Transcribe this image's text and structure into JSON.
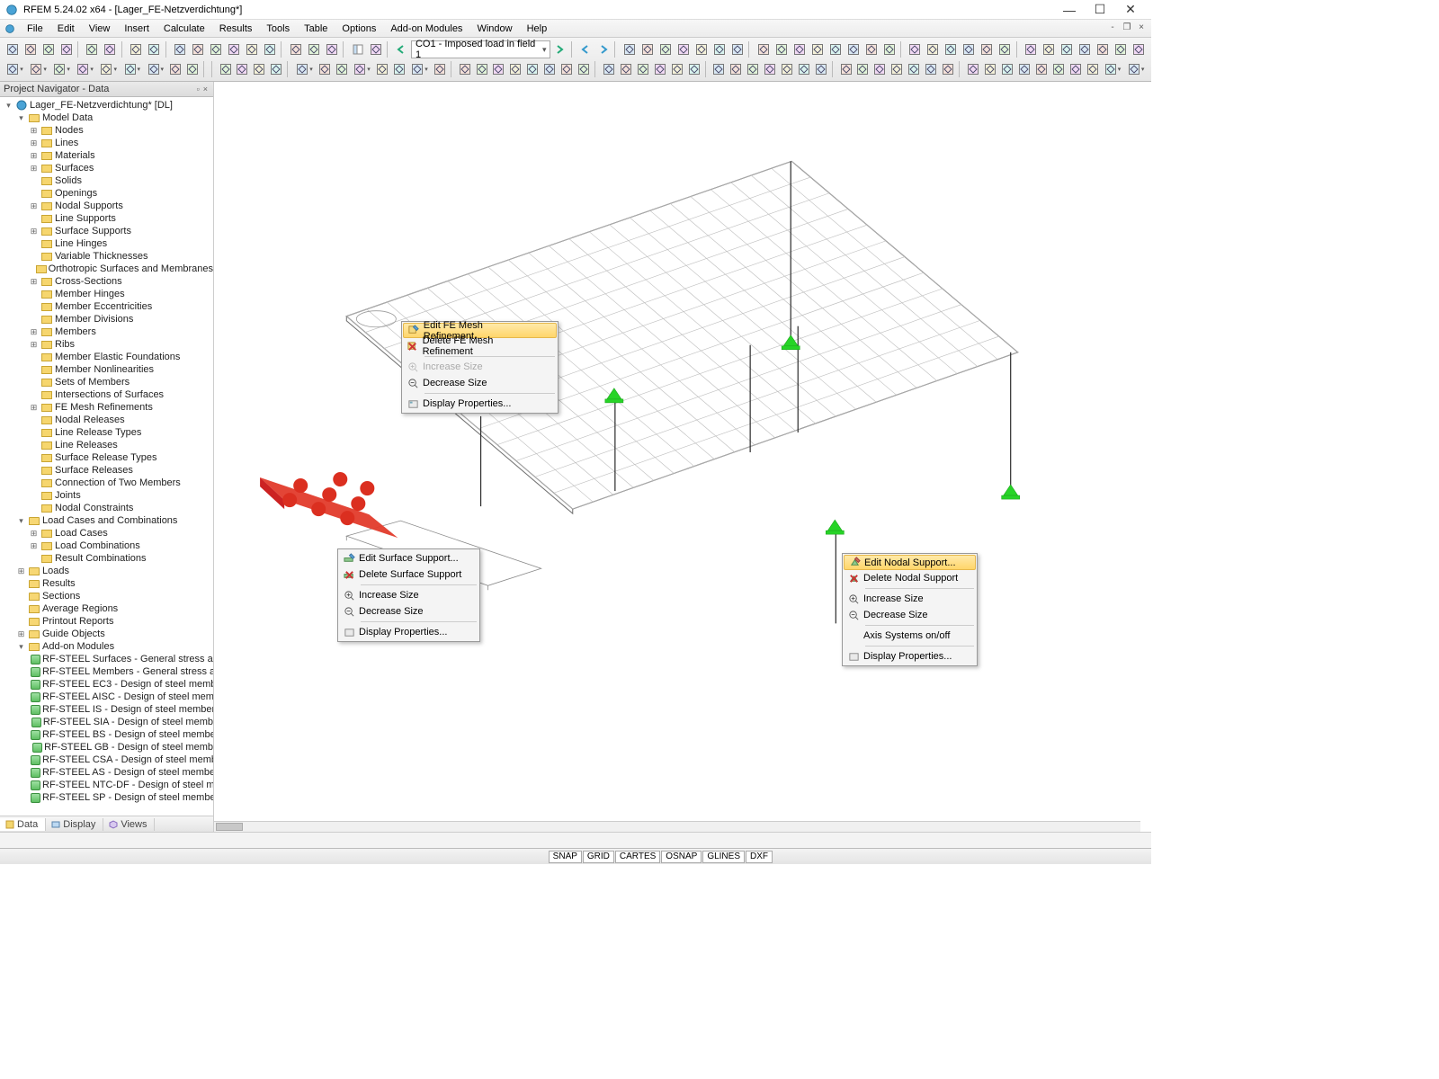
{
  "title": "RFEM 5.24.02 x64 - [Lager_FE-Netzverdichtung*]",
  "menubar": [
    "File",
    "Edit",
    "View",
    "Insert",
    "Calculate",
    "Results",
    "Tools",
    "Table",
    "Options",
    "Add-on Modules",
    "Window",
    "Help"
  ],
  "combo_loadcase": "CO1 - Imposed load in field 1",
  "nav": {
    "header": "Project Navigator - Data",
    "root": "Lager_FE-Netzverdichtung* [DL]",
    "modeldata": "Model Data",
    "items_md": [
      "Nodes",
      "Lines",
      "Materials",
      "Surfaces",
      "Solids",
      "Openings",
      "Nodal Supports",
      "Line Supports",
      "Surface Supports",
      "Line Hinges",
      "Variable Thicknesses",
      "Orthotropic Surfaces and Membranes",
      "Cross-Sections",
      "Member Hinges",
      "Member Eccentricities",
      "Member Divisions",
      "Members",
      "Ribs",
      "Member Elastic Foundations",
      "Member Nonlinearities",
      "Sets of Members",
      "Intersections of Surfaces",
      "FE Mesh Refinements",
      "Nodal Releases",
      "Line Release Types",
      "Line Releases",
      "Surface Release Types",
      "Surface Releases",
      "Connection of Two Members",
      "Joints",
      "Nodal Constraints"
    ],
    "md_expanders": {
      "Nodes": "+",
      "Lines": "+",
      "Materials": "+",
      "Surfaces": "+",
      "Nodal Supports": "+",
      "Surface Supports": "+",
      "Cross-Sections": "+",
      "Members": "+",
      "Ribs": "+",
      "FE Mesh Refinements": "+"
    },
    "lcc": "Load Cases and Combinations",
    "items_lcc": [
      "Load Cases",
      "Load Combinations",
      "Result Combinations"
    ],
    "after": [
      "Loads",
      "Results",
      "Sections",
      "Average Regions",
      "Printout Reports",
      "Guide Objects"
    ],
    "after_expanders": {
      "Loads": "+",
      "Guide Objects": "+"
    },
    "addon": "Add-on Modules",
    "mods": [
      "RF-STEEL Surfaces - General stress an",
      "RF-STEEL Members - General stress a",
      "RF-STEEL EC3 - Design of steel memb",
      "RF-STEEL AISC - Design of steel mem",
      "RF-STEEL IS - Design of steel member",
      "RF-STEEL SIA - Design of steel memb",
      "RF-STEEL BS - Design of steel membe",
      "RF-STEEL GB - Design of steel memb",
      "RF-STEEL CSA - Design of steel memb",
      "RF-STEEL AS - Design of steel membe",
      "RF-STEEL NTC-DF - Design of steel m",
      "RF-STEEL SP - Design of steel membe"
    ],
    "tabs": [
      "Data",
      "Display",
      "Views"
    ]
  },
  "ctx_fe": {
    "items": [
      "Edit FE Mesh Refinement...",
      "Delete FE Mesh Refinement",
      "Increase Size",
      "Decrease Size",
      "Display Properties..."
    ]
  },
  "ctx_surf": {
    "items": [
      "Edit Surface Support...",
      "Delete Surface Support",
      "Increase Size",
      "Decrease Size",
      "Display Properties..."
    ]
  },
  "ctx_nodal": {
    "items": [
      "Edit Nodal Support...",
      "Delete Nodal Support",
      "Increase Size",
      "Decrease Size",
      "Axis Systems on/off",
      "Display Properties..."
    ]
  },
  "status": [
    "SNAP",
    "GRID",
    "CARTES",
    "OSNAP",
    "GLINES",
    "DXF"
  ]
}
